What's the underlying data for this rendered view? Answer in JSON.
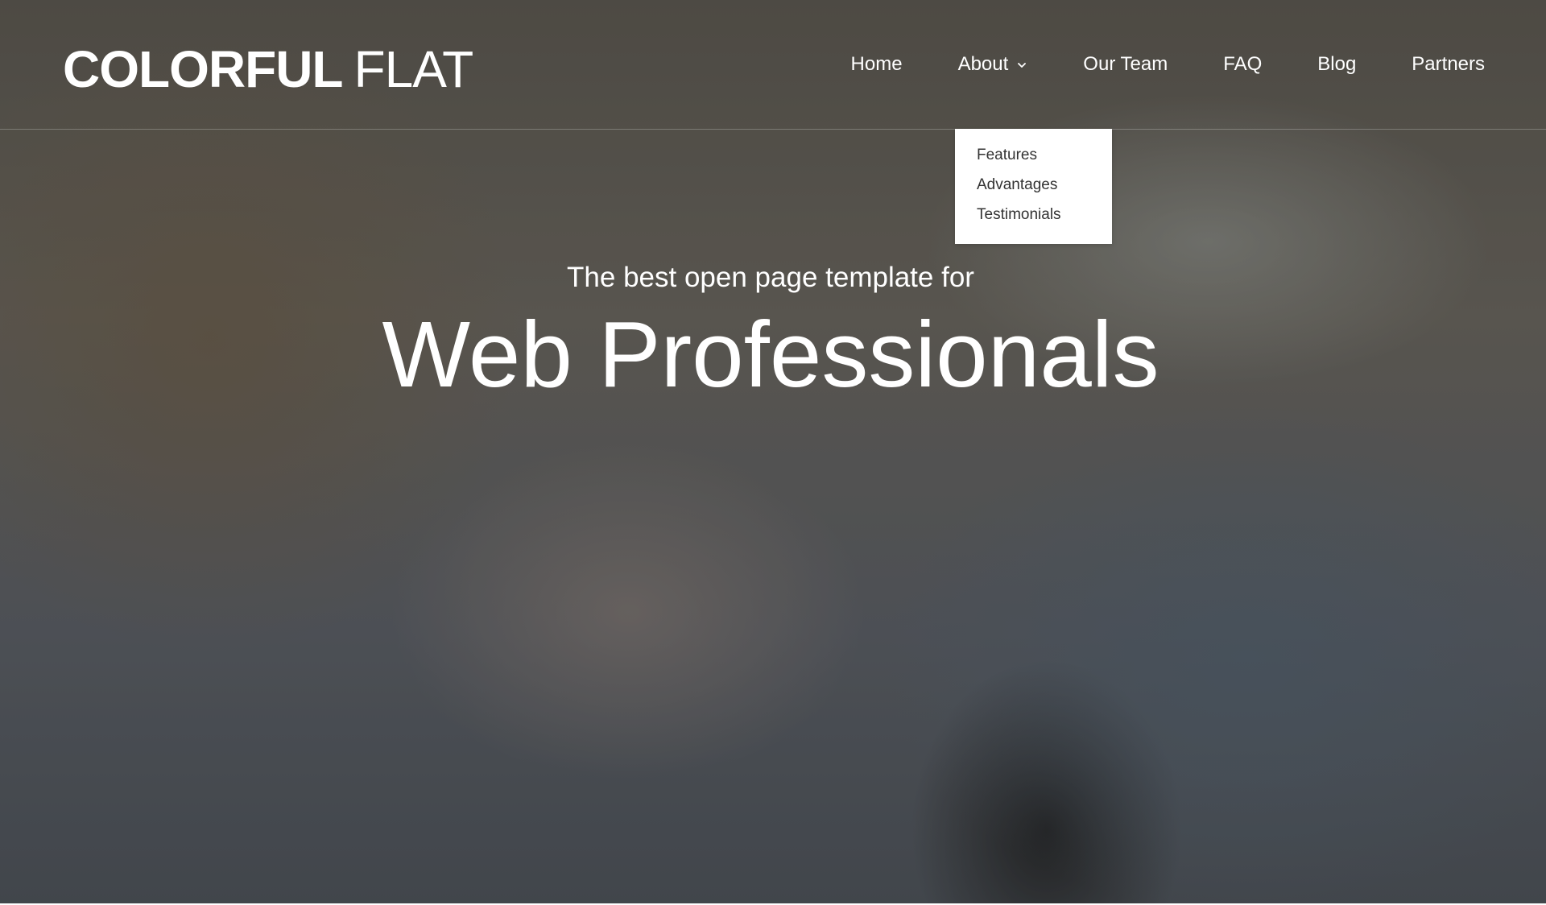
{
  "brand": {
    "logo_bold": "COLORFUL",
    "logo_light": "FLAT"
  },
  "nav": {
    "items": [
      {
        "label": "Home"
      },
      {
        "label": "About"
      },
      {
        "label": "Our Team"
      },
      {
        "label": "FAQ"
      },
      {
        "label": "Blog"
      },
      {
        "label": "Partners"
      }
    ],
    "about_dropdown": {
      "items": [
        {
          "label": "Features"
        },
        {
          "label": "Advantages"
        },
        {
          "label": "Testimonials"
        }
      ]
    }
  },
  "hero": {
    "tagline": "The best open page template  for",
    "headline": "Web Professionals"
  },
  "icons": {
    "dropdown_chevron": "chevron-down-icon"
  },
  "colors": {
    "text": "#ffffff",
    "dropdown_bg": "#ffffff",
    "dropdown_text": "#333333"
  }
}
